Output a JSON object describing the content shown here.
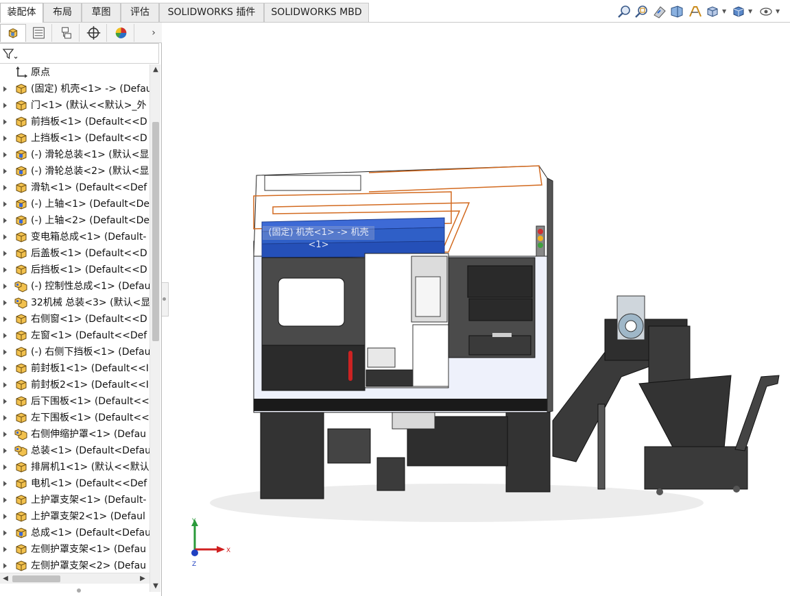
{
  "command_tabs": [
    {
      "label": "装配体",
      "active": true
    },
    {
      "label": "布局",
      "active": false
    },
    {
      "label": "草图",
      "active": false
    },
    {
      "label": "评估",
      "active": false
    },
    {
      "label": "SOLIDWORKS 插件",
      "active": false
    },
    {
      "label": "SOLIDWORKS MBD",
      "active": false
    }
  ],
  "hud_icons": [
    "zoom-to-fit-icon",
    "zoom-to-area-icon",
    "previous-view-icon",
    "section-view-icon",
    "dynamic-annotation-icon",
    "view-orientation-icon",
    "display-style-icon",
    "hide-show-items-icon"
  ],
  "panel_tabs": [
    "featuremanager-tree-icon",
    "propertymanager-icon",
    "configurationmanager-icon",
    "dimxpertmanager-icon",
    "display-manager-icon"
  ],
  "tree": {
    "origin_label": "原点",
    "items": [
      {
        "label": "(固定) 机壳<1> -> (Defau",
        "icon": "part"
      },
      {
        "label": "门<1> (默认<<默认>_外",
        "icon": "part"
      },
      {
        "label": "前挡板<1> (Default<<D",
        "icon": "part"
      },
      {
        "label": "上挡板<1> (Default<<D",
        "icon": "part"
      },
      {
        "label": "(-) 滑轮总装<1> (默认<显",
        "icon": "part-blue"
      },
      {
        "label": "(-) 滑轮总装<2> (默认<显",
        "icon": "part-blue"
      },
      {
        "label": "滑轨<1> (Default<<Def",
        "icon": "part"
      },
      {
        "label": "(-) 上轴<1> (Default<De",
        "icon": "part-blue"
      },
      {
        "label": "(-) 上轴<2> (Default<De",
        "icon": "part-blue"
      },
      {
        "label": "变电箱总成<1> (Default-",
        "icon": "part"
      },
      {
        "label": "后盖板<1> (Default<<D",
        "icon": "part"
      },
      {
        "label": "后挡板<1> (Default<<D",
        "icon": "part"
      },
      {
        "label": "(-) 控制性总成<1> (Defau",
        "icon": "assembly"
      },
      {
        "label": "32机械 总装<3> (默认<显",
        "icon": "assembly"
      },
      {
        "label": "右侧窗<1> (Default<<D",
        "icon": "part"
      },
      {
        "label": "左窗<1> (Default<<Def",
        "icon": "part"
      },
      {
        "label": "(-) 右侧下挡板<1> (Defau",
        "icon": "part"
      },
      {
        "label": "前封板1<1> (Default<<I",
        "icon": "part"
      },
      {
        "label": "前封板2<1> (Default<<I",
        "icon": "part"
      },
      {
        "label": "后下围板<1> (Default<<",
        "icon": "part"
      },
      {
        "label": "左下围板<1> (Default<<",
        "icon": "part"
      },
      {
        "label": "右侧伸缩护罩<1> (Defau",
        "icon": "assembly"
      },
      {
        "label": "总装<1> (Default<Defau",
        "icon": "assembly"
      },
      {
        "label": "排屑机1<1> (默认<<默认",
        "icon": "part"
      },
      {
        "label": "电机<1> (Default<<Def",
        "icon": "part"
      },
      {
        "label": "上护罩支架<1> (Default-",
        "icon": "part"
      },
      {
        "label": "上护罩支架2<1> (Defaul",
        "icon": "part"
      },
      {
        "label": "总成<1> (Default<Defau",
        "icon": "part-blue"
      },
      {
        "label": "左侧护罩支架<1> (Defau",
        "icon": "part"
      },
      {
        "label": "左侧护罩支架<2> (Defau",
        "icon": "part"
      }
    ]
  },
  "viewport": {
    "hover_label": "(固定) 机壳<1> -> 机壳<1>",
    "triad": {
      "x_label": "X",
      "y_label": "Y",
      "z_label": "Z"
    }
  },
  "colors": {
    "accent_blue": "#2f5fc7",
    "selection_orange": "#d2691e",
    "part_yellow": "#f2c14e",
    "body_dark": "#3a3a3a"
  }
}
